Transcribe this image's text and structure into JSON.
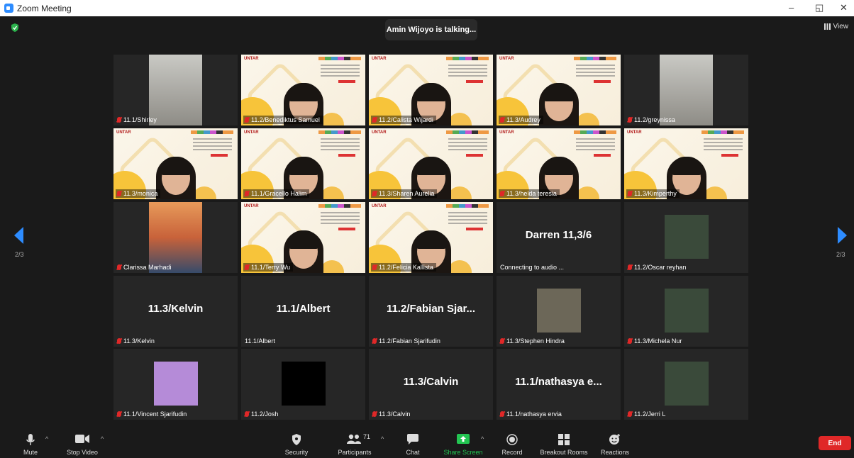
{
  "window": {
    "title": "Zoom Meeting",
    "minimize": "–",
    "restore": "◱",
    "close": "✕"
  },
  "banner": {
    "talking": "Amin Wijoyo is talking..."
  },
  "view_button": {
    "label": "View"
  },
  "pagination": {
    "left": "2/3",
    "right": "2/3"
  },
  "tiles": [
    {
      "name": "11.1/Shirley",
      "type": "camera",
      "muted": true
    },
    {
      "name": "11.2/Benediktus Samuel",
      "type": "slide",
      "muted": true
    },
    {
      "name": "11.2/Calista Wijardi",
      "type": "slide",
      "muted": true
    },
    {
      "name": "11.3/Audrey",
      "type": "slide",
      "muted": true
    },
    {
      "name": "11.2/greynissa",
      "type": "camera",
      "muted": true
    },
    {
      "name": "11.3/monica",
      "type": "slide",
      "muted": true
    },
    {
      "name": "11.1/Gracello Halim",
      "type": "slide",
      "muted": true
    },
    {
      "name": "11.3/Sharen Aurelia",
      "type": "slide",
      "muted": true
    },
    {
      "name": "11.3/helda teresia",
      "type": "slide",
      "muted": true
    },
    {
      "name": "11.3/Kimperthy",
      "type": "slide",
      "muted": true
    },
    {
      "name": "Clarissa Marhadi",
      "type": "camera",
      "muted": true
    },
    {
      "name": "11.1/Terry Wu",
      "type": "slide",
      "muted": true
    },
    {
      "name": "11.2/Felicia Kallista",
      "type": "slide",
      "muted": true
    },
    {
      "name": "Connecting to audio ...",
      "display": "Darren 11,3/6",
      "type": "nameonly",
      "muted": false
    },
    {
      "name": "11.2/Oscar reyhan",
      "type": "avatar",
      "muted": true
    },
    {
      "name": "11.3/Kelvin",
      "display": "11.3/Kelvin",
      "type": "nameonly",
      "muted": true
    },
    {
      "name": "11.1/Albert",
      "display": "11.1/Albert",
      "type": "nameonly",
      "muted": false
    },
    {
      "name": "11.2/Fabian Sjarifudin",
      "display": "11.2/Fabian  Sjar...",
      "type": "nameonly",
      "muted": true
    },
    {
      "name": "11.3/Stephen Hindra",
      "type": "avatar",
      "muted": true
    },
    {
      "name": "11.3/Michela Nur",
      "type": "avatar",
      "muted": true
    },
    {
      "name": "11.1/Vincent Sjarifudin",
      "type": "avatar",
      "muted": true
    },
    {
      "name": "11.2/Josh",
      "type": "black",
      "muted": true
    },
    {
      "name": "11.3/Calvin",
      "display": "11.3/Calvin",
      "type": "nameonly",
      "muted": true
    },
    {
      "name": "11.1/nathasya ervia",
      "display": "11.1/nathasya  e...",
      "type": "nameonly",
      "muted": true
    },
    {
      "name": "11.2/Jerri L",
      "type": "avatar",
      "muted": true
    }
  ],
  "slide": {
    "logo": "UNTAR"
  },
  "toolbar": {
    "mute": "Mute",
    "stop_video": "Stop Video",
    "security": "Security",
    "participants": "Participants",
    "participants_count": "71",
    "chat": "Chat",
    "share_screen": "Share Screen",
    "record": "Record",
    "breakout_rooms": "Breakout Rooms",
    "reactions": "Reactions",
    "end": "End"
  },
  "colors": {
    "accent": "#2d8cff",
    "share_green": "#23c552",
    "end_red": "#e02828",
    "muted_red": "#e02828"
  }
}
